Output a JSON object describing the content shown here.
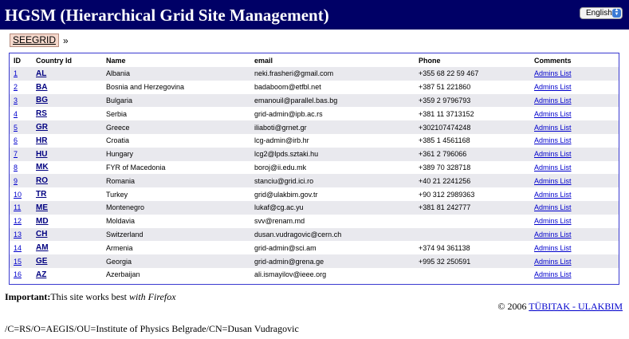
{
  "header": {
    "title": "HGSM (Hierarchical Grid Site Management)",
    "language_selected": "English",
    "bg_color": "#000066"
  },
  "breadcrumb": {
    "item": "SEEGRID",
    "separator": "»"
  },
  "table": {
    "columns": [
      "ID",
      "Country Id",
      "Name",
      "email",
      "Phone",
      "Comments"
    ],
    "rows": [
      {
        "id": "1",
        "cc": "AL",
        "name": "Albania",
        "email": "neki.frasheri@gmail.com",
        "phone": "+355 68 22 59 467",
        "comment": "Admins List"
      },
      {
        "id": "2",
        "cc": "BA",
        "name": "Bosnia and Herzegovina",
        "email": "badaboom@etfbl.net",
        "phone": "+387 51 221860",
        "comment": "Admins List"
      },
      {
        "id": "3",
        "cc": "BG",
        "name": "Bulgaria",
        "email": "emanouil@parallel.bas.bg",
        "phone": "+359 2 9796793",
        "comment": "Admins List"
      },
      {
        "id": "4",
        "cc": "RS",
        "name": "Serbia",
        "email": "grid-admin@ipb.ac.rs",
        "phone": "+381 11 3713152",
        "comment": "Admins List"
      },
      {
        "id": "5",
        "cc": "GR",
        "name": "Greece",
        "email": "iliaboti@grnet.gr",
        "phone": "+302107474248",
        "comment": "Admins List"
      },
      {
        "id": "6",
        "cc": "HR",
        "name": "Croatia",
        "email": "lcg-admin@irb.hr",
        "phone": "+385 1 4561168",
        "comment": "Admins List"
      },
      {
        "id": "7",
        "cc": "HU",
        "name": "Hungary",
        "email": "lcg2@lpds.sztaki.hu",
        "phone": "+361 2 796066",
        "comment": "Admins List"
      },
      {
        "id": "8",
        "cc": "MK",
        "name": "FYR of Macedonia",
        "email": "boroj@ii.edu.mk",
        "phone": "+389 70 328718",
        "comment": "Admins List"
      },
      {
        "id": "9",
        "cc": "RO",
        "name": "Romania",
        "email": "stanciu@grid.ici.ro",
        "phone": "+40 21 2241256",
        "comment": "Admins List"
      },
      {
        "id": "10",
        "cc": "TR",
        "name": "Turkey",
        "email": "grid@ulakbim.gov.tr",
        "phone": "+90 312 2989363",
        "comment": "Admins List"
      },
      {
        "id": "11",
        "cc": "ME",
        "name": "Montenegro",
        "email": "lukaf@cg.ac.yu",
        "phone": "+381 81 242777",
        "comment": "Admins List"
      },
      {
        "id": "12",
        "cc": "MD",
        "name": "Moldavia",
        "email": "svv@renam.md",
        "phone": "",
        "comment": "Admins List"
      },
      {
        "id": "13",
        "cc": "CH",
        "name": "Switzerland",
        "email": "dusan.vudragovic@cern.ch",
        "phone": "",
        "comment": "Admins List"
      },
      {
        "id": "14",
        "cc": "AM",
        "name": "Armenia",
        "email": "grid-admin@sci.am",
        "phone": "+374 94 361138",
        "comment": "Admins List"
      },
      {
        "id": "15",
        "cc": "GE",
        "name": "Georgia",
        "email": "grid-admin@grena.ge",
        "phone": "+995 32 250591",
        "comment": "Admins List"
      },
      {
        "id": "16",
        "cc": "AZ",
        "name": "Azerbaijan",
        "email": "ali.ismayilov@ieee.org",
        "phone": "",
        "comment": "Admins List"
      }
    ]
  },
  "footer": {
    "important_label": "Important:",
    "important_text": "This site works best ",
    "important_emph": "with Firefox",
    "copyright_prefix": "© 2006 ",
    "link1": "TÜBITAK ",
    "link_sep": "- ",
    "link2": "ULAKBIM",
    "dn": "/C=RS/O=AEGIS/OU=Institute of Physics Belgrade/CN=Dusan Vudragovic"
  }
}
